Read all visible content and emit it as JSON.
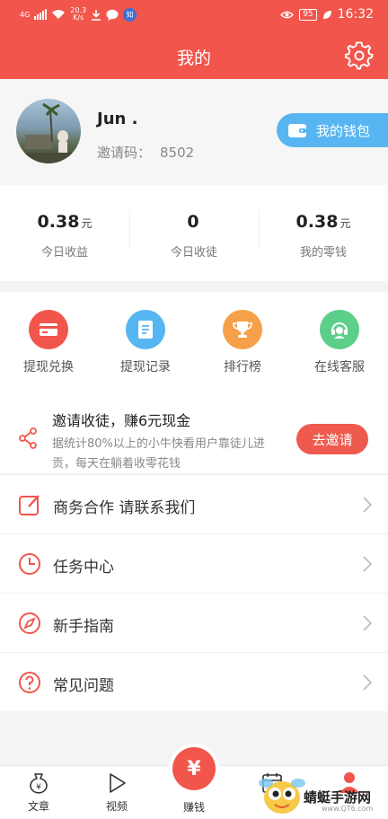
{
  "status_bar": {
    "network": "4G",
    "speed_value": "20.3",
    "speed_unit": "K/s",
    "zhi_badge": "知",
    "battery": "95",
    "time": "16:32"
  },
  "nav": {
    "title": "我的"
  },
  "profile": {
    "name": "Jun .",
    "invite_label": "邀请码：",
    "invite_code": "8502",
    "wallet_button": "我的钱包"
  },
  "stats": [
    {
      "value": "0.38",
      "unit": "元",
      "label": "今日收益"
    },
    {
      "value": "0",
      "unit": "",
      "label": "今日收徒"
    },
    {
      "value": "0.38",
      "unit": "元",
      "label": "我的零钱"
    }
  ],
  "actions": [
    {
      "label": "提现兑换",
      "icon": "card-icon",
      "color": "#f2554b"
    },
    {
      "label": "提现记录",
      "icon": "record-icon",
      "color": "#56b6f1"
    },
    {
      "label": "排行榜",
      "icon": "trophy-icon",
      "color": "#f6a04a"
    },
    {
      "label": "在线客服",
      "icon": "headset-icon",
      "color": "#5ccf8a"
    }
  ],
  "invite": {
    "title": "邀请收徒，赚6元现金",
    "desc": "据统计80%以上的小牛快看用户靠徒儿进贡，每天在躺着收零花钱",
    "button": "去邀请"
  },
  "menu": [
    {
      "label": "商务合作 请联系我们",
      "icon": "edit-icon"
    },
    {
      "label": "任务中心",
      "icon": "clock-icon"
    },
    {
      "label": "新手指南",
      "icon": "compass-icon"
    },
    {
      "label": "常见问题",
      "icon": "question-icon"
    }
  ],
  "tabbar": {
    "articles": "文章",
    "videos": "视频",
    "earn": "赚钱",
    "earn_symbol": "¥"
  },
  "watermark": {
    "text": "蜻蜓手游网",
    "url": "www.QT6.com"
  },
  "colors": {
    "primary": "#f2554b",
    "wallet": "#57b6f2"
  }
}
